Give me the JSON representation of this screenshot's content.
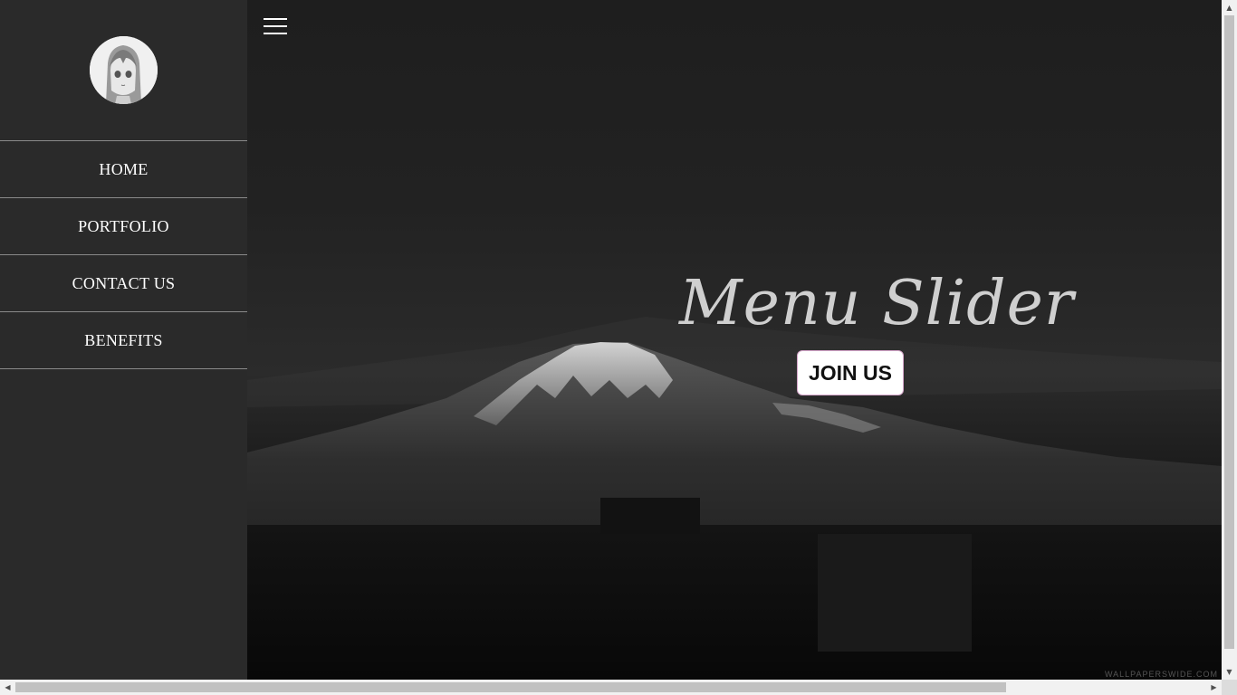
{
  "sidebar": {
    "avatar_icon": "anime-girl-avatar",
    "items": [
      {
        "label": "HOME"
      },
      {
        "label": "PORTFOLIO"
      },
      {
        "label": "CONTACT US"
      },
      {
        "label": "BENEFITS"
      }
    ]
  },
  "header": {
    "menu_icon": "hamburger-icon"
  },
  "hero": {
    "title": "Menu Slider",
    "cta_label": "JOIN US",
    "watermark": "WALLPAPERSWIDE.COM"
  },
  "colors": {
    "sidebar_bg": "#2a2a2a",
    "menu_text": "#ffffff",
    "title_text": "#cfcfcf",
    "button_bg": "#ffffff",
    "button_border": "#d4a5c9"
  }
}
